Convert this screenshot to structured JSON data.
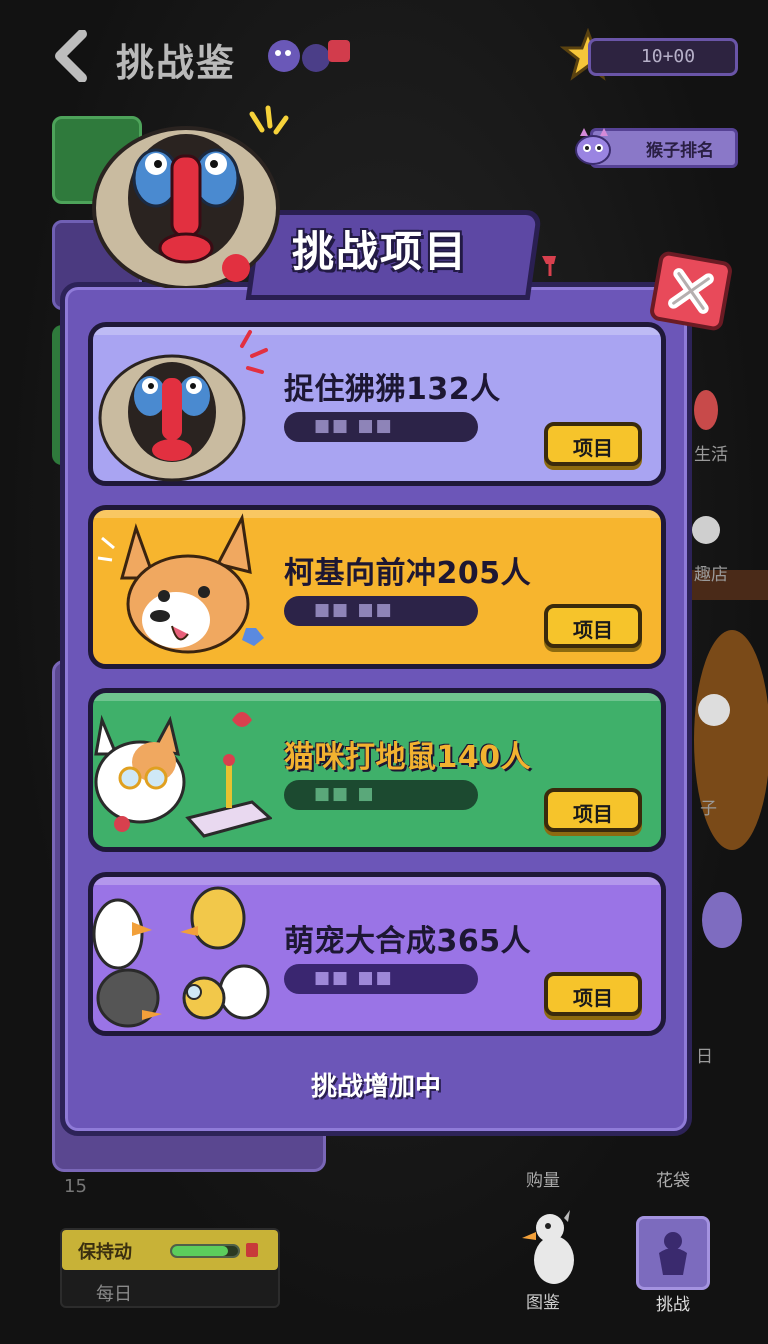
{
  "header": {
    "title": "挑战鉴",
    "currency": "10+00",
    "rank_button": "猴子排名"
  },
  "background": {
    "left_number": "15",
    "right_labels": [
      "生活",
      "趣店",
      "子",
      "日"
    ],
    "daily": {
      "label": "保持动",
      "sub_label": "每日",
      "progress": 0.85
    },
    "nav": {
      "left_top_label": "购量",
      "right_top_label": "花袋",
      "tujian_label": "图鉴",
      "tiaozhan_label": "挑战"
    }
  },
  "modal": {
    "title": "挑战项目",
    "footer": "挑战增加中",
    "cards": [
      {
        "name": "捉住狒狒132人",
        "button": "项目",
        "bar_text": "■■ ■■",
        "color": "#a9a4f2",
        "name_color": "#1d1733",
        "image": "mandrill-icon"
      },
      {
        "name": "柯基向前冲205人",
        "button": "项目",
        "bar_text": "■■ ■■",
        "color": "#f7b52e",
        "name_color": "#1d1733",
        "image": "corgi-icon"
      },
      {
        "name": "猫咪打地鼠140人",
        "button": "项目",
        "bar_text": "■■ ■",
        "color": "#3fb06a",
        "name_color": "#f2b230",
        "image": "cat-joystick-icon"
      },
      {
        "name": "萌宠大合成365人",
        "button": "项目",
        "bar_text": "■■ ■■",
        "color": "#9a74e6",
        "name_color": "#fff",
        "image": "duck-group-icon"
      }
    ]
  }
}
